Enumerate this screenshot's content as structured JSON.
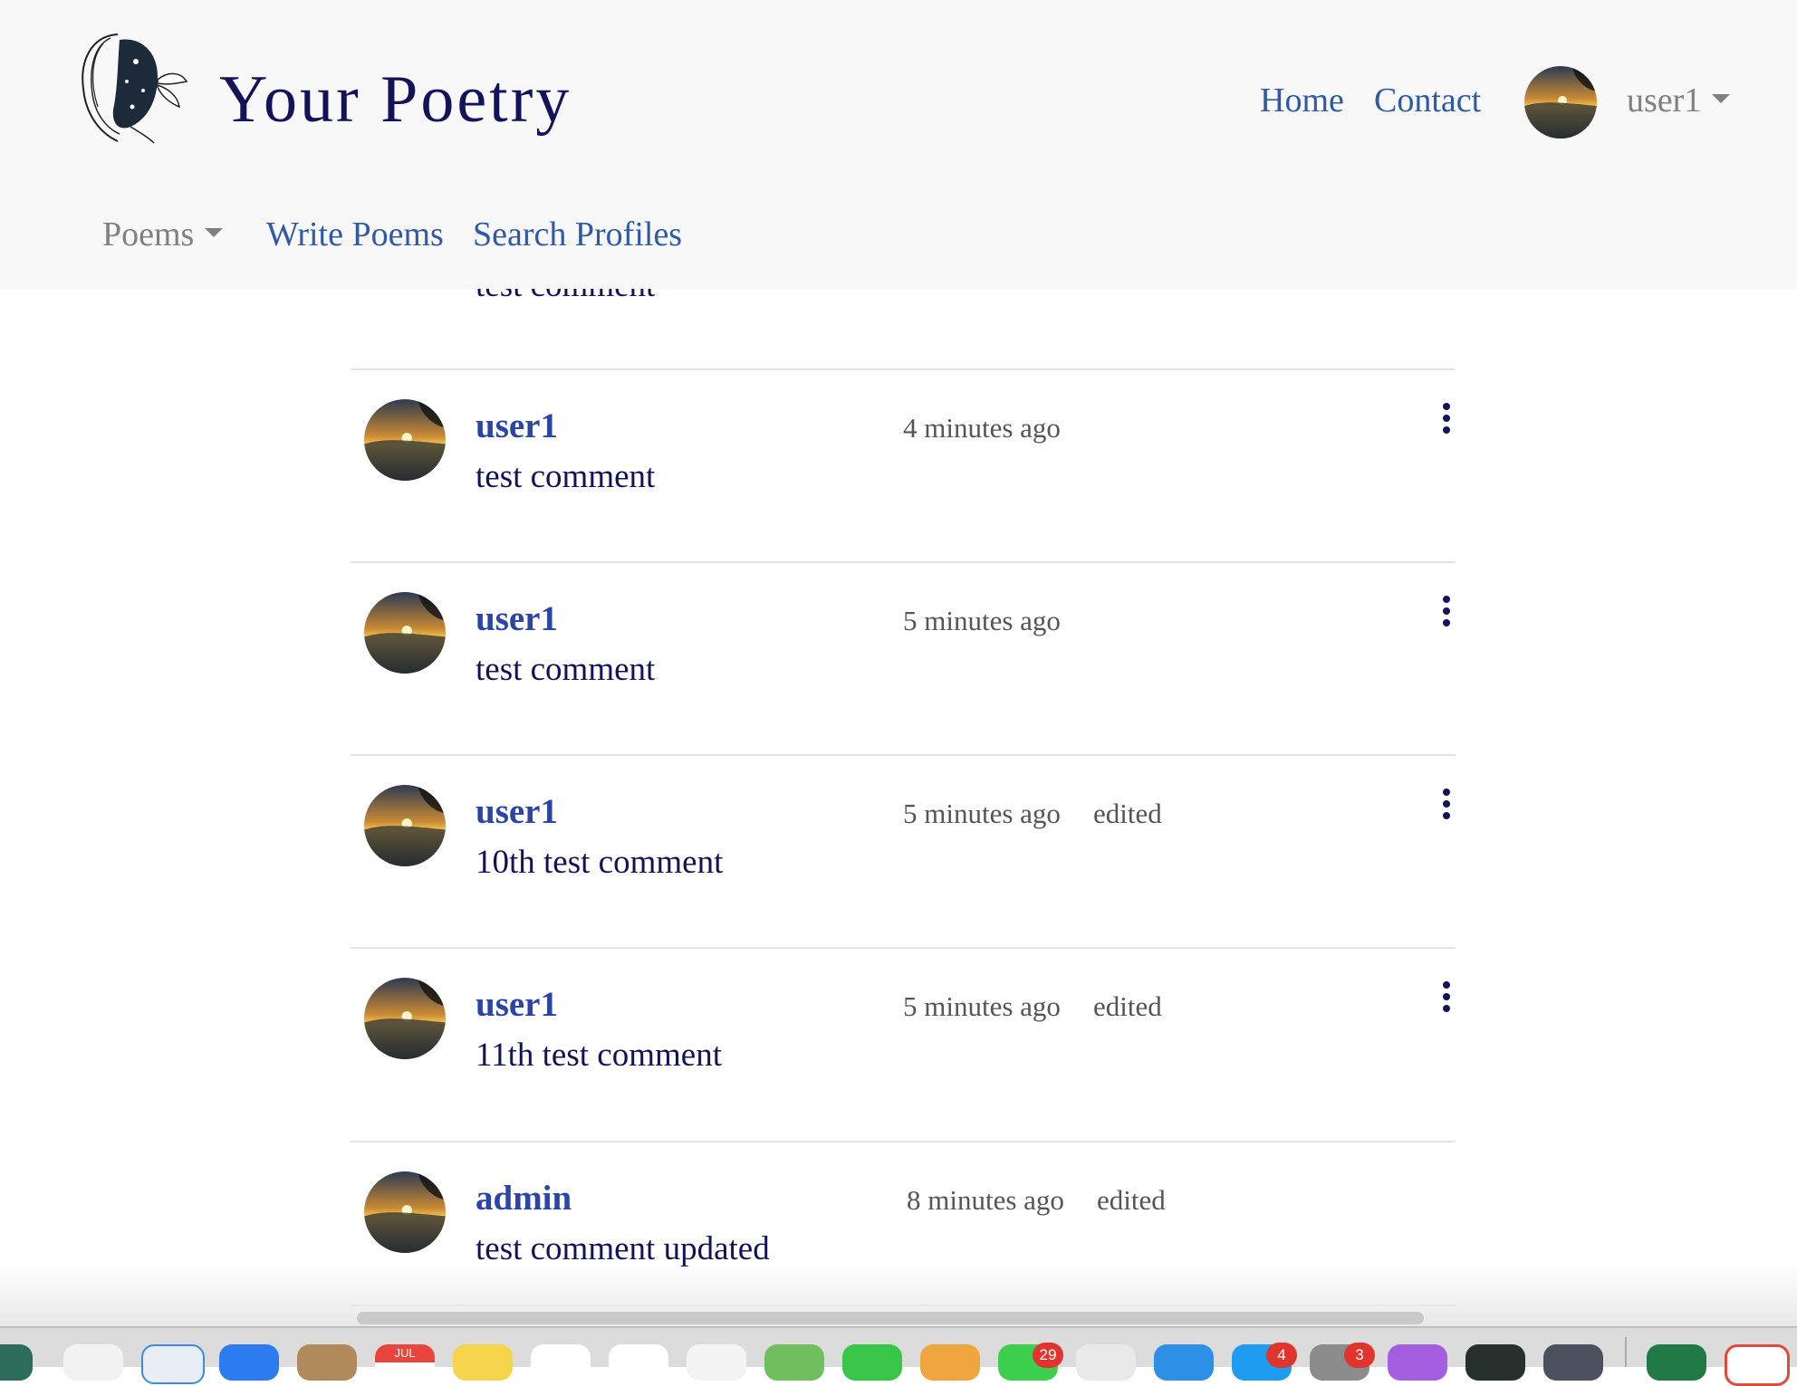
{
  "brand": {
    "title": "Your Poetry"
  },
  "nav": {
    "home": "Home",
    "contact": "Contact",
    "user": "user1",
    "poems": "Poems",
    "write": "Write Poems",
    "search": "Search Profiles"
  },
  "partial_comment": {
    "text": "test comment"
  },
  "comments": [
    {
      "user": "user1",
      "time": "4 minutes ago",
      "edited": "",
      "text": "test comment",
      "has_menu": true
    },
    {
      "user": "user1",
      "time": "5 minutes ago",
      "edited": "",
      "text": "test comment",
      "has_menu": true
    },
    {
      "user": "user1",
      "time": "5 minutes ago",
      "edited": "edited",
      "text": "10th test comment",
      "has_menu": true
    },
    {
      "user": "user1",
      "time": "5 minutes ago",
      "edited": "edited",
      "text": "11th test comment",
      "has_menu": true
    },
    {
      "user": "admin",
      "time": "8 minutes ago",
      "edited": "edited",
      "text": "test comment updated",
      "has_menu": false
    }
  ],
  "dock": {
    "calendar_month": "JUL",
    "badges": [
      "29",
      "4",
      "3"
    ]
  },
  "colors": {
    "brand": "#13135a",
    "link": "#2e5aa7",
    "username": "#2a45a6",
    "muted": "#808080"
  }
}
